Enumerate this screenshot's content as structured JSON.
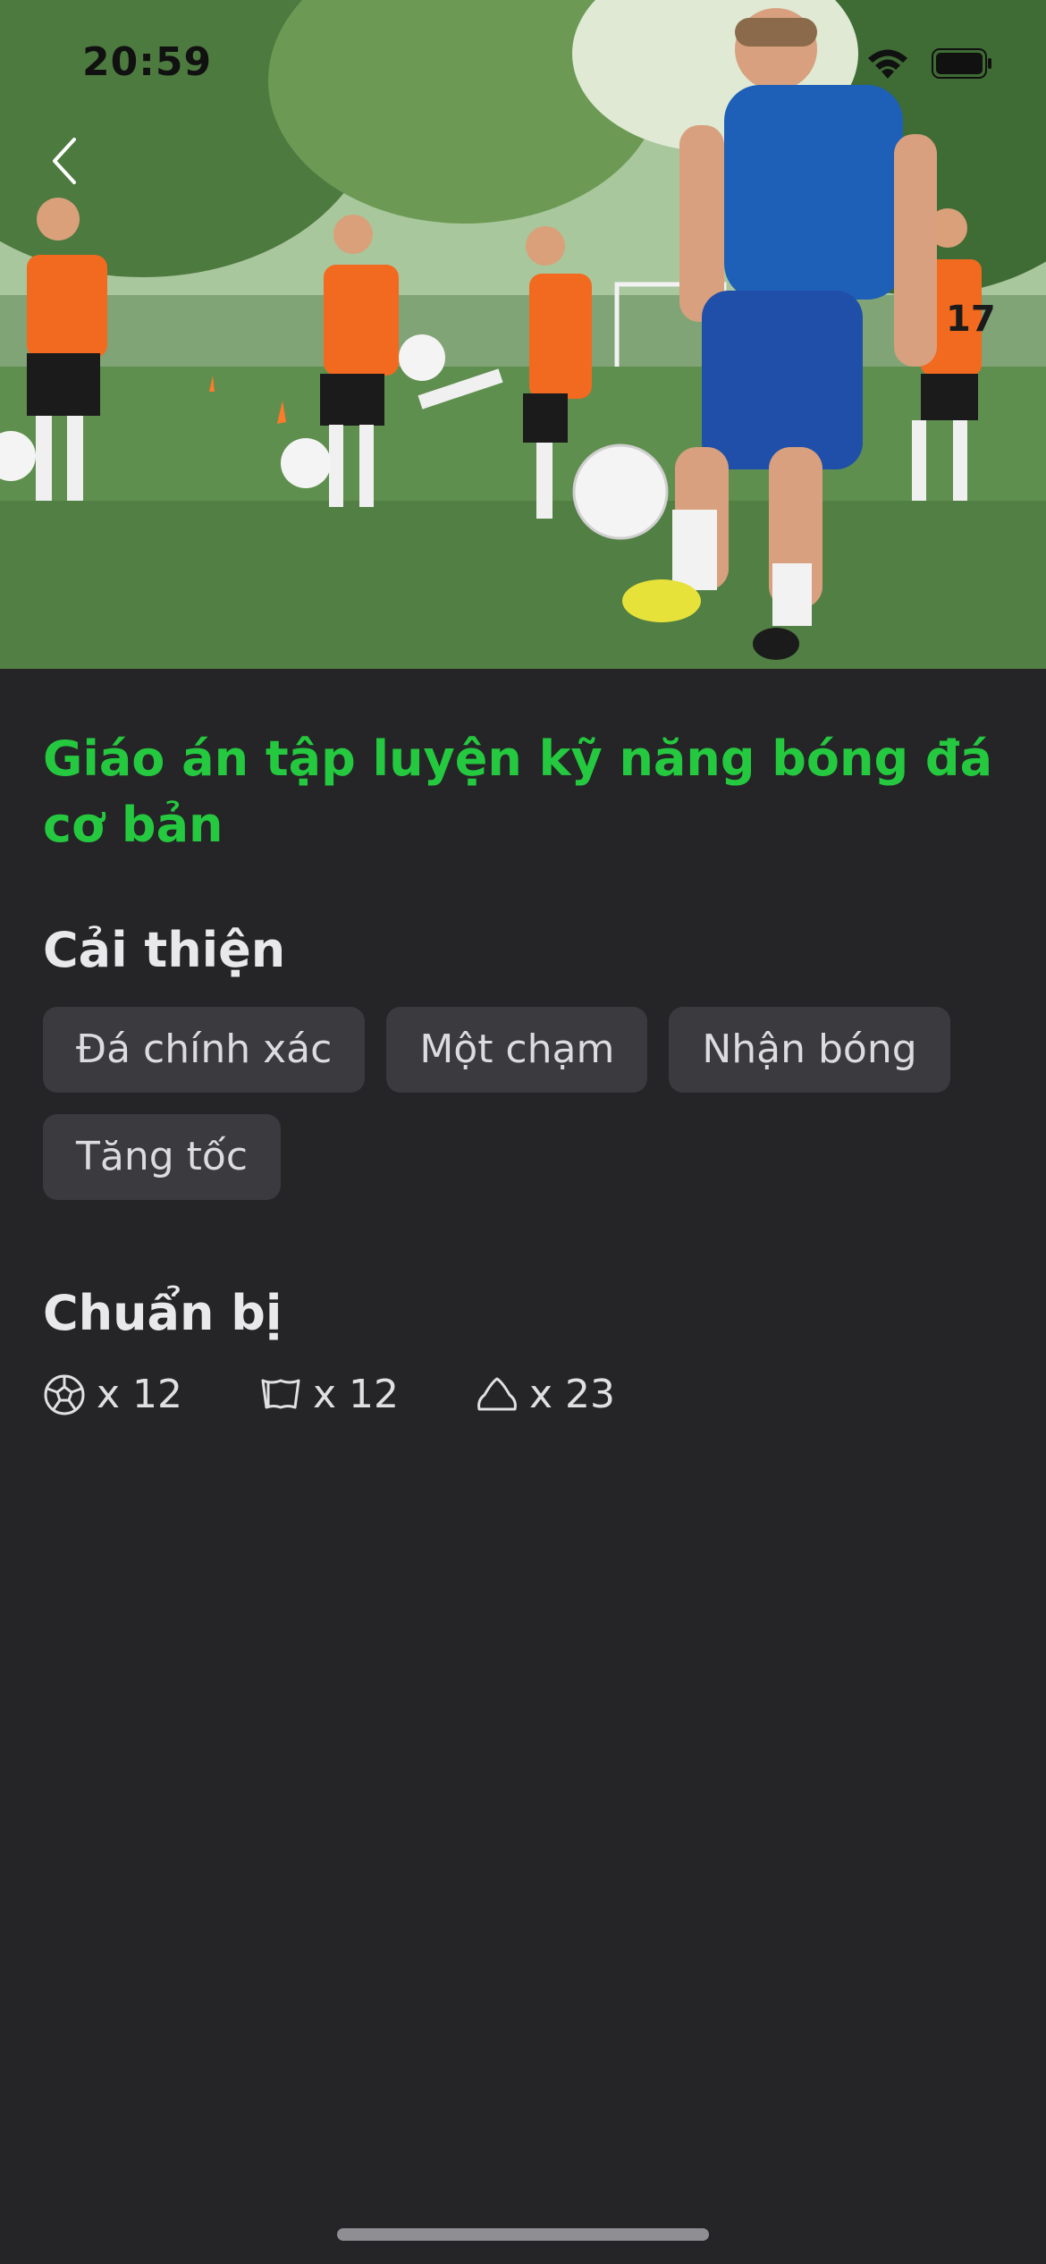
{
  "status_bar": {
    "time": "20:59"
  },
  "hero": {
    "image_subject": "coach-and-youth-players-juggling-footballs",
    "jersey_number": "17"
  },
  "navigation": {
    "back_icon": "chevron-left-icon"
  },
  "lesson": {
    "title": "Giáo án tập luyện kỹ năng bóng đá cơ bản"
  },
  "improve": {
    "heading": "Cải thiện",
    "skills": [
      "Đá chính xác",
      "Một chạm",
      "Nhận bóng",
      "Tăng tốc"
    ]
  },
  "prepare": {
    "heading": "Chuẩn bị",
    "equipment": [
      {
        "icon": "soccer-ball-icon",
        "label": "x 12"
      },
      {
        "icon": "training-bib-icon",
        "label": "x 12"
      },
      {
        "icon": "training-cone-icon",
        "label": "x 23"
      }
    ]
  },
  "colors": {
    "accent": "#25c93f",
    "background": "#252527",
    "chip": "#3a3a3f"
  }
}
